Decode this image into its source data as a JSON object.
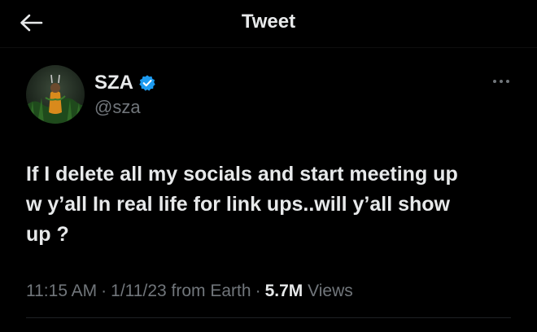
{
  "header": {
    "title": "Tweet",
    "back_icon": "arrow-left-icon"
  },
  "author": {
    "name": "SZA",
    "handle": "@sza",
    "verified": true,
    "verified_icon": "verified-badge-icon",
    "avatar_icon": "avatar-image"
  },
  "more_icon": "more-dots-icon",
  "tweet": {
    "text": "If I delete all my socials and start meeting up\nw y’all In real life for link ups..will y’all show\nup ?"
  },
  "meta": {
    "time": "11:15 AM",
    "separator": "·",
    "date": "1/11/23",
    "source": "from Earth",
    "views_count": "5.7M",
    "views_label": "Views"
  },
  "colors": {
    "background": "#000000",
    "text_primary": "#e7e9ea",
    "text_secondary": "#71767b",
    "verified_blue": "#1d9bf0"
  }
}
